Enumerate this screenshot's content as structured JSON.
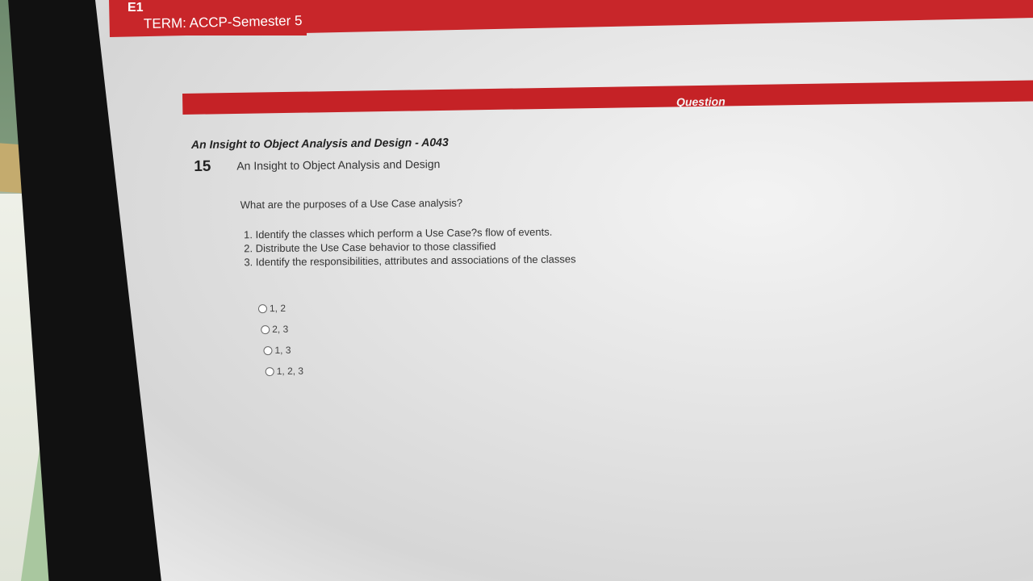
{
  "header": {
    "code": "E1",
    "term": "TERM: ACCP-Semester 5"
  },
  "question_bar": {
    "label": "Question"
  },
  "question": {
    "subject": "An Insight to Object Analysis and Design - A043",
    "number": "15",
    "topic": "An Insight to Object Analysis and Design",
    "text": "What are the purposes of a Use Case analysis?",
    "statements": [
      "1. Identify the classes which perform a Use Case?s flow of events.",
      "2. Distribute the Use Case behavior to those classified",
      "3. Identify the responsibilities, attributes and associations of the classes"
    ],
    "options": [
      {
        "label": "1, 2",
        "selected": false
      },
      {
        "label": "2, 3",
        "selected": false
      },
      {
        "label": "1, 3",
        "selected": false
      },
      {
        "label": "1, 2, 3",
        "selected": false
      }
    ]
  }
}
